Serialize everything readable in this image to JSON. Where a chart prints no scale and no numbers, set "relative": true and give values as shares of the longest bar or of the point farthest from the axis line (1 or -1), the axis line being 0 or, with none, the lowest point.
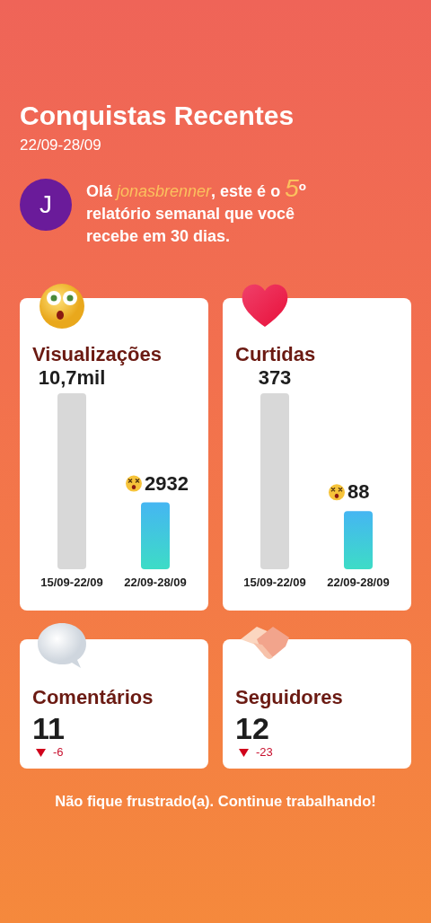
{
  "header": {
    "title": "Conquistas Recentes",
    "date_range": "22/09-28/09"
  },
  "greeting": {
    "avatar_initial": "J",
    "message": "Olá *jonasbrenner*, este é o *5*$^{o}$ relatório semanal que você recebe em 30 dias."
  },
  "chart_cards": [
    {
      "title": "Visualizações",
      "bar_labels": [
        "10,7mil",
        "2932"
      ],
      "chart_data": {
        "type": "bar",
        "categories": [
          "15/09-22/09",
          "22/09-28/09"
        ],
        "relative": true,
        "values": [
          1,
          0.38
        ]
      }
    },
    {
      "title": "Curtidas",
      "bar_labels": [
        "373",
        "88"
      ],
      "chart_data": {
        "type": "bar",
        "categories": [
          "15/09-22/09",
          "22/09-28/09"
        ],
        "relative": true,
        "values": [
          1,
          0.33
        ]
      }
    }
  ],
  "stat_cards": [
    {
      "title": "Comentários",
      "value": "11",
      "change": "-6",
      "kind": "down"
    },
    {
      "title": "Seguidores",
      "value": "12",
      "change": "-23",
      "kind": "down"
    }
  ],
  "footer": {
    "message": "Não fique frustrado(a). Continue trabalhando!"
  }
}
